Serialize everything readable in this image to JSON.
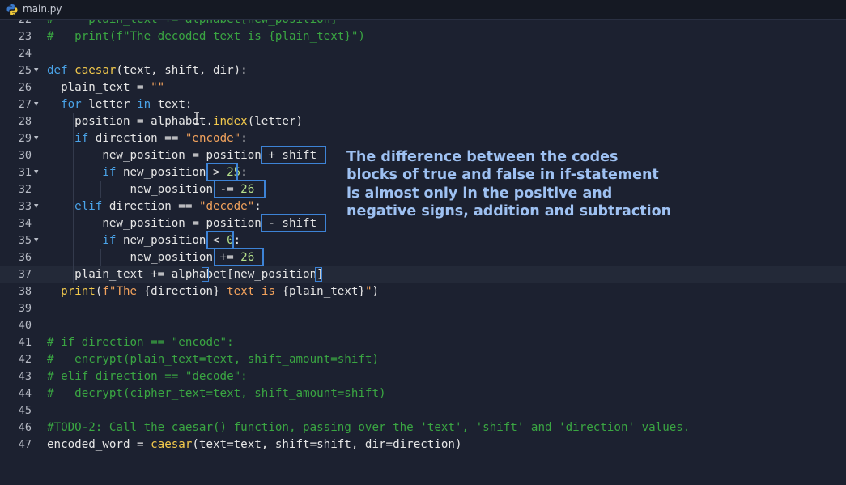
{
  "tab": {
    "filename": "main.py",
    "icon": "python-icon"
  },
  "annotation": {
    "lines": [
      "The difference between the codes",
      "blocks of true and false in if-statement",
      "is almost only in the positive and",
      "negative signs, addition and subtraction"
    ],
    "color": "#9ec1f2"
  },
  "colors": {
    "keyword": "#4aa3e8",
    "function": "#f2c94c",
    "string": "#f2a25c",
    "number": "#b5e08a",
    "comment": "#3aa642",
    "highlight_box": "#3d83d6",
    "background": "#1c2130"
  },
  "active_line": 37,
  "code_lines": [
    {
      "n": "22",
      "fold": false,
      "indent": 0,
      "tokens": [
        [
          "cm",
          "#     plain_text += alphabet[new_position]"
        ]
      ]
    },
    {
      "n": "23",
      "fold": false,
      "indent": 0,
      "tokens": [
        [
          "cm",
          "#   print(f\"The decoded text is {plain_text}\")"
        ]
      ]
    },
    {
      "n": "24",
      "fold": false,
      "indent": 0,
      "tokens": []
    },
    {
      "n": "25",
      "fold": true,
      "indent": 0,
      "tokens": [
        [
          "kw",
          "def "
        ],
        [
          "fn",
          "caesar"
        ],
        [
          "pl",
          "(text, shift, dir):"
        ]
      ]
    },
    {
      "n": "26",
      "fold": false,
      "indent": 1,
      "tokens": [
        [
          "pl",
          "  plain_text = "
        ],
        [
          "str",
          "\"\""
        ]
      ]
    },
    {
      "n": "27",
      "fold": true,
      "indent": 1,
      "tokens": [
        [
          "pl",
          "  "
        ],
        [
          "kw",
          "for"
        ],
        [
          "pl",
          " letter "
        ],
        [
          "kw",
          "in"
        ],
        [
          "pl",
          " text:"
        ]
      ]
    },
    {
      "n": "28",
      "fold": false,
      "indent": 2,
      "tokens": [
        [
          "pl",
          "    position = alphabet."
        ],
        [
          "fn",
          "index"
        ],
        [
          "pl",
          "(letter)"
        ]
      ]
    },
    {
      "n": "29",
      "fold": true,
      "indent": 2,
      "tokens": [
        [
          "pl",
          "    "
        ],
        [
          "kw",
          "if"
        ],
        [
          "pl",
          " direction == "
        ],
        [
          "str",
          "\"encode\""
        ],
        [
          "pl",
          ":"
        ]
      ]
    },
    {
      "n": "30",
      "fold": false,
      "indent": 3,
      "tokens": [
        [
          "pl",
          "        new_position = position + shift"
        ]
      ]
    },
    {
      "n": "31",
      "fold": true,
      "indent": 3,
      "tokens": [
        [
          "pl",
          "        "
        ],
        [
          "kw",
          "if"
        ],
        [
          "pl",
          " new_position > "
        ],
        [
          "num",
          "25"
        ],
        [
          "pl",
          ":"
        ]
      ]
    },
    {
      "n": "32",
      "fold": false,
      "indent": 4,
      "tokens": [
        [
          "pl",
          "            new_position -= "
        ],
        [
          "num",
          "26"
        ]
      ]
    },
    {
      "n": "33",
      "fold": true,
      "indent": 2,
      "tokens": [
        [
          "pl",
          "    "
        ],
        [
          "kw",
          "elif"
        ],
        [
          "pl",
          " direction == "
        ],
        [
          "str",
          "\"decode\""
        ],
        [
          "pl",
          ":"
        ]
      ]
    },
    {
      "n": "34",
      "fold": false,
      "indent": 3,
      "tokens": [
        [
          "pl",
          "        new_position = position - shift"
        ]
      ]
    },
    {
      "n": "35",
      "fold": true,
      "indent": 3,
      "tokens": [
        [
          "pl",
          "        "
        ],
        [
          "kw",
          "if"
        ],
        [
          "pl",
          " new_position < "
        ],
        [
          "num",
          "0"
        ],
        [
          "pl",
          ":"
        ]
      ]
    },
    {
      "n": "36",
      "fold": false,
      "indent": 4,
      "tokens": [
        [
          "pl",
          "            new_position += "
        ],
        [
          "num",
          "26"
        ]
      ]
    },
    {
      "n": "37",
      "fold": false,
      "indent": 2,
      "tokens": [
        [
          "pl",
          "    plain_text += alphabet[new_position]"
        ]
      ]
    },
    {
      "n": "38",
      "fold": false,
      "indent": 1,
      "tokens": [
        [
          "pl",
          "  "
        ],
        [
          "fn",
          "print"
        ],
        [
          "pl",
          "("
        ],
        [
          "str",
          "f\"The "
        ],
        [
          "pl",
          "{direction}"
        ],
        [
          "str",
          " text is "
        ],
        [
          "pl",
          "{plain_text}"
        ],
        [
          "str",
          "\""
        ],
        [
          "pl",
          ")"
        ]
      ]
    },
    {
      "n": "39",
      "fold": false,
      "indent": 0,
      "tokens": []
    },
    {
      "n": "40",
      "fold": false,
      "indent": 0,
      "tokens": []
    },
    {
      "n": "41",
      "fold": false,
      "indent": 0,
      "tokens": [
        [
          "cm",
          "# if direction == \"encode\":"
        ]
      ]
    },
    {
      "n": "42",
      "fold": false,
      "indent": 0,
      "tokens": [
        [
          "cm",
          "#   encrypt(plain_text=text, shift_amount=shift)"
        ]
      ]
    },
    {
      "n": "43",
      "fold": false,
      "indent": 0,
      "tokens": [
        [
          "cm",
          "# elif direction == \"decode\":"
        ]
      ]
    },
    {
      "n": "44",
      "fold": false,
      "indent": 0,
      "tokens": [
        [
          "cm",
          "#   decrypt(cipher_text=text, shift_amount=shift)"
        ]
      ]
    },
    {
      "n": "45",
      "fold": false,
      "indent": 0,
      "tokens": []
    },
    {
      "n": "46",
      "fold": false,
      "indent": 0,
      "tokens": [
        [
          "cm",
          "#TODO-2: Call the caesar() function, passing over the 'text', 'shift' and 'direction' values."
        ]
      ]
    },
    {
      "n": "47",
      "fold": false,
      "indent": 0,
      "tokens": [
        [
          "pl",
          "encoded_word = "
        ],
        [
          "fn",
          "caesar"
        ],
        [
          "pl",
          "(text=text, shift=shift, dir=direction)"
        ]
      ]
    }
  ]
}
